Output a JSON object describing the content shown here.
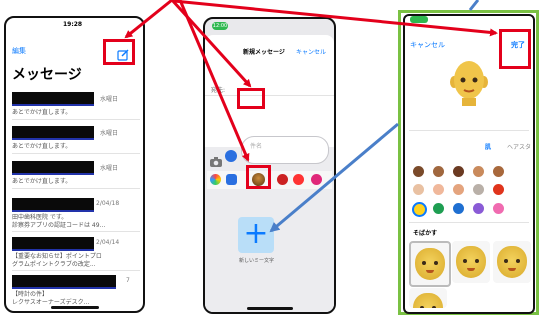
{
  "panel1": {
    "time": "19:28",
    "edit": "編集",
    "title": "メッセージ",
    "compose_icon": "compose-icon",
    "rows": [
      {
        "date": "水曜日",
        "preview": "あとでかけ直します。"
      },
      {
        "date": "水曜日",
        "preview": "あとでかけ直します。"
      },
      {
        "date": "水曜日",
        "preview": "あとでかけ直します。"
      },
      {
        "date": "2/04/18",
        "preview1": "田中歯科医院 です。",
        "preview2": "診察券アプリの認証コードは 49..."
      },
      {
        "date": "2/04/14",
        "preview1": "【重要なお知らせ】ポイントプロ",
        "preview2": "グラムポイントクラブの改定..."
      },
      {
        "date": "7",
        "preview1": "【時計の件】",
        "preview2": "レクサスオーナーズデスク..."
      }
    ]
  },
  "panel2": {
    "time": "12:00",
    "title": "新規メッセージ",
    "cancel": "キャンセル",
    "to": "宛先:",
    "subject_placeholder": "件名",
    "new_memoji": "新しいミー文字",
    "plus": "+"
  },
  "panel3": {
    "cancel": "キャンセル",
    "done": "完了",
    "tab_skin": "肌",
    "tab_hair": "ヘアスタ",
    "freckles": "そばかす",
    "skin_colors": [
      "#7a4a2a",
      "#a0673e",
      "#6b3a22",
      "#c98a5c",
      "#a8683c",
      "#e9c1a2",
      "#f0b89b",
      "#e4a47e",
      "#b9b0a8",
      "#e0341c",
      "#ffd21f",
      "#1e9e52",
      "#1f6fd1",
      "#8a5bd6",
      "#f06bb0"
    ]
  },
  "colors": {
    "red": "#e3001b",
    "blue_arrow": "#4a7fc9",
    "green": "#7ac143",
    "ios_blue": "#0a7aff"
  }
}
